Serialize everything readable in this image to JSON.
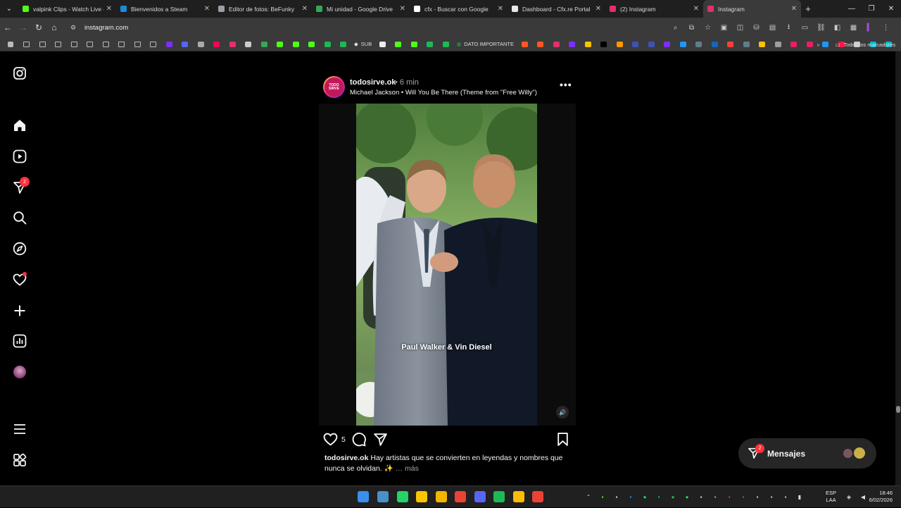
{
  "browser": {
    "tabs": [
      {
        "title": "valpink Clips - Watch Live on",
        "color": "#53fc18"
      },
      {
        "title": "Bienvenidos a Steam",
        "color": "#1b8ad8"
      },
      {
        "title": "Editor de fotos: BeFunky",
        "color": "#9aa0a6"
      },
      {
        "title": "Mi unidad - Google Drive",
        "color": "#34a853"
      },
      {
        "title": "cfx - Buscar con Google",
        "color": "#ffffff"
      },
      {
        "title": "Dashboard - Cfx.re Portal",
        "color": "#e8e8e8"
      },
      {
        "title": "(2) Instagram",
        "color": "#e1306c"
      },
      {
        "title": "Instagram",
        "color": "#e1306c",
        "active": true
      }
    ],
    "url": "instagram.com",
    "bookmarks": {
      "sub_label": "SUB",
      "dato_label": "DATO IMPORTANTE",
      "all_label": "Todos los marcadores",
      "icon_colors": [
        "#7b2ff7",
        "#5865f2",
        "#aaaaaa",
        "#ff0050",
        "#e1306c",
        "#cccccc",
        "#34a853",
        "#53fc18",
        "#53fc18",
        "#53fc18",
        "#1db954",
        "#1db954"
      ],
      "icon_colors_2": [
        "#ff5722",
        "#ff5722",
        "#e1306c",
        "#7b2ff7",
        "#f7c600",
        "#000000",
        "#ff9800",
        "#3f51b5",
        "#3f51b5",
        "#7b2ff7",
        "#2196f3",
        "#607d8b",
        "#1565c0",
        "#f44336",
        "#607d8b",
        "#ffc107",
        "#9e9e9e",
        "#e91e63",
        "#e91e63",
        "#2196f3",
        "#ff1744",
        "#cccccc",
        "#00bcd4",
        "#00bcd4",
        "#4caf50",
        "#4caf50"
      ]
    }
  },
  "post": {
    "username": "todosirve.ok",
    "time_ago": "• 6 min",
    "song_artist": "Michael Jackson",
    "song_title": "Will You Be There (Theme from \"Free Willy\")",
    "avatar_text": "TODO SIRVE",
    "overlay_caption": "Paul Walker & Vin Diesel",
    "likes": "5",
    "caption_user": "todosirve.ok",
    "caption_text": "Hay artistas que se convierten en leyendas y nombres que nunca se olvidan. ✨",
    "caption_more": "… más"
  },
  "sidebar": {
    "share_badge": "2"
  },
  "messages": {
    "label": "Mensajes",
    "badge": "2"
  },
  "taskbar": {
    "lang_top": "ESP",
    "lang_bottom": "LAA",
    "time": "18:46",
    "date": "6/02/2026",
    "apps": [
      {
        "name": "start",
        "color": "#3b8eea"
      },
      {
        "name": "app-2",
        "color": "#4a90c8"
      },
      {
        "name": "whatsapp",
        "color": "#25d366"
      },
      {
        "name": "notes",
        "color": "#f7c600"
      },
      {
        "name": "folder",
        "color": "#f2b600"
      },
      {
        "name": "chrome",
        "color": "#ea4335"
      },
      {
        "name": "discord",
        "color": "#5865f2"
      },
      {
        "name": "spotify",
        "color": "#1db954"
      },
      {
        "name": "chrome-2",
        "color": "#fbbc05"
      },
      {
        "name": "chrome-3",
        "color": "#ea4335"
      }
    ]
  }
}
